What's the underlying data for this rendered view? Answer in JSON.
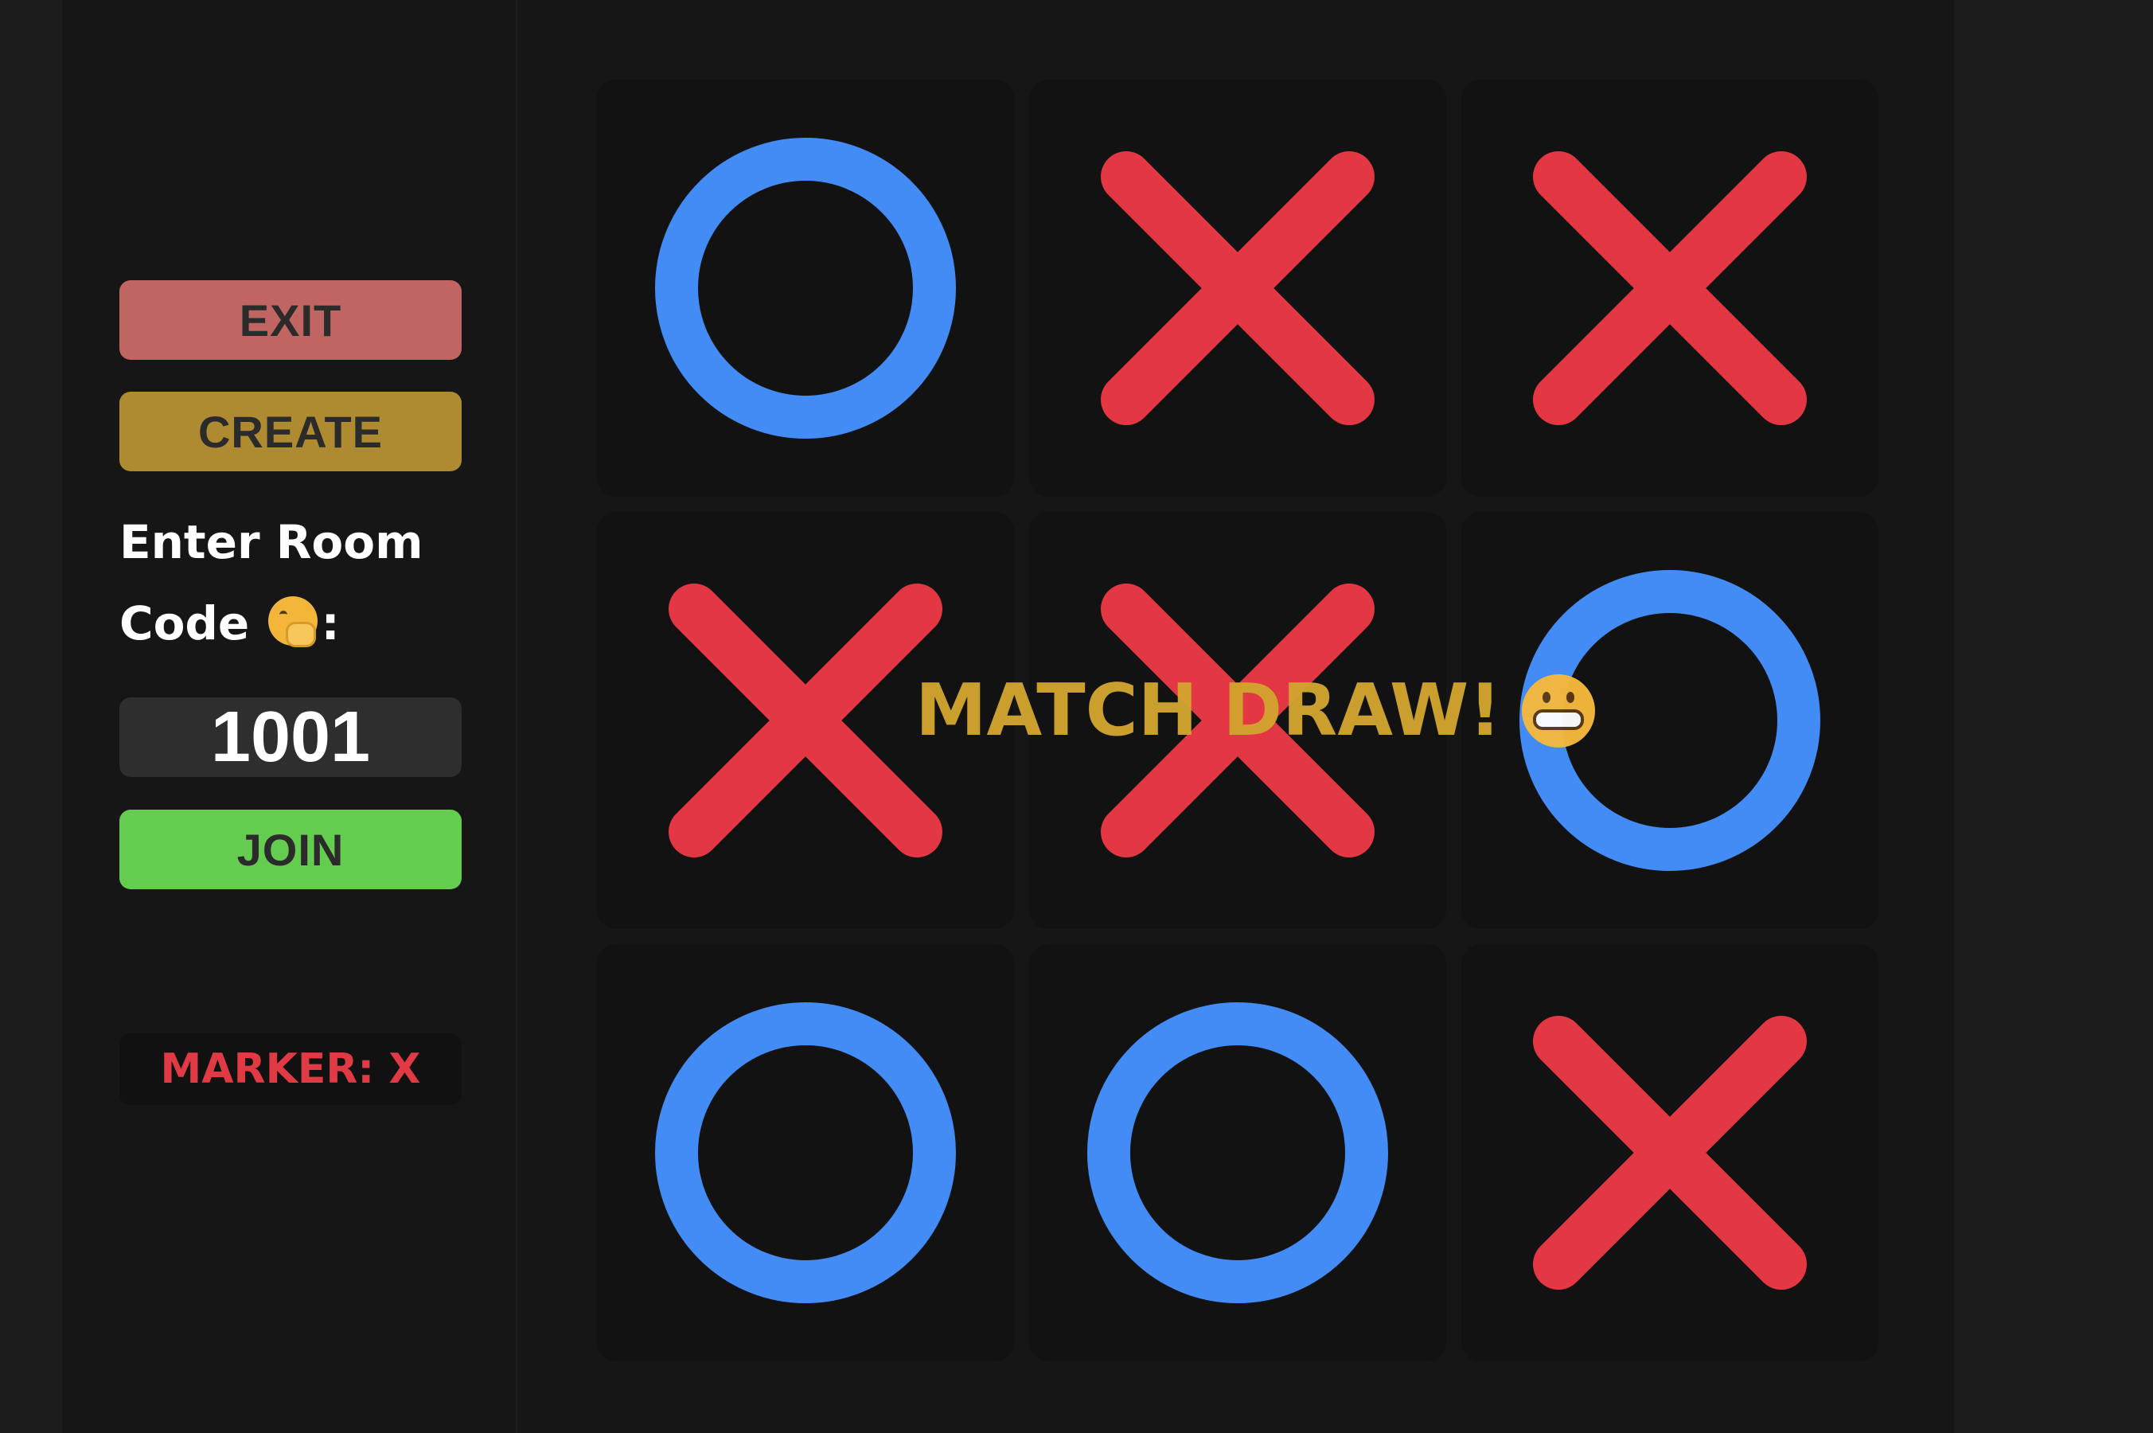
{
  "sidebar": {
    "exit_label": "EXIT",
    "create_label": "CREATE",
    "room_label": "Enter Room Code",
    "room_label_suffix": ":",
    "room_emoji": "hand-over-mouth-emoji",
    "room_code": "1001",
    "join_label": "JOIN",
    "marker_label": "MARKER: X"
  },
  "board": {
    "cells": [
      "O",
      "X",
      "X",
      "X",
      "X",
      "O",
      "O",
      "O",
      "X"
    ]
  },
  "result": {
    "message": "MATCH DRAW!",
    "emoji": "grimacing-face-emoji"
  },
  "colors": {
    "x_mark": "#e33743",
    "o_mark": "#438cf5",
    "exit_button": "#c06561",
    "create_button": "#ae8a30",
    "join_button": "#64cc4e",
    "result_text": "#d3a530",
    "marker_text": "#e03a45"
  }
}
